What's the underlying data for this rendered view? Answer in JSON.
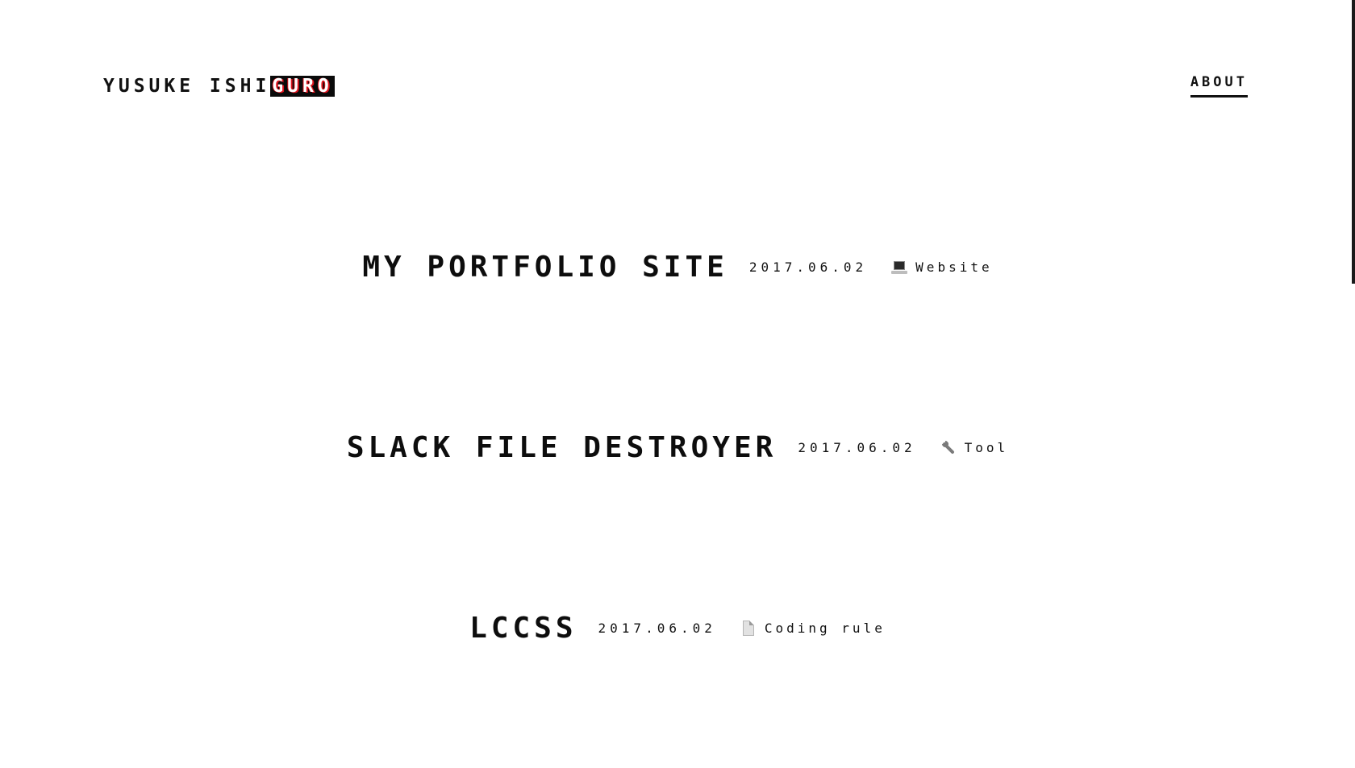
{
  "header": {
    "logo_main": "YUSUKE ISHI",
    "logo_glitch": "GURO",
    "nav_about": "ABOUT"
  },
  "projects": [
    {
      "title": "MY PORTFOLIO SITE",
      "date": "2017.06.02",
      "category": "Website",
      "icon": "laptop-icon"
    },
    {
      "title": "SLACK FILE DESTROYER",
      "date": "2017.06.02",
      "category": "Tool",
      "icon": "wrench-icon"
    },
    {
      "title": "LCCSS",
      "date": "2017.06.02",
      "category": "Coding rule",
      "icon": "document-icon"
    }
  ],
  "colors": {
    "background": "#ffffff",
    "text": "#111111",
    "glitch_red": "#e0141e"
  }
}
